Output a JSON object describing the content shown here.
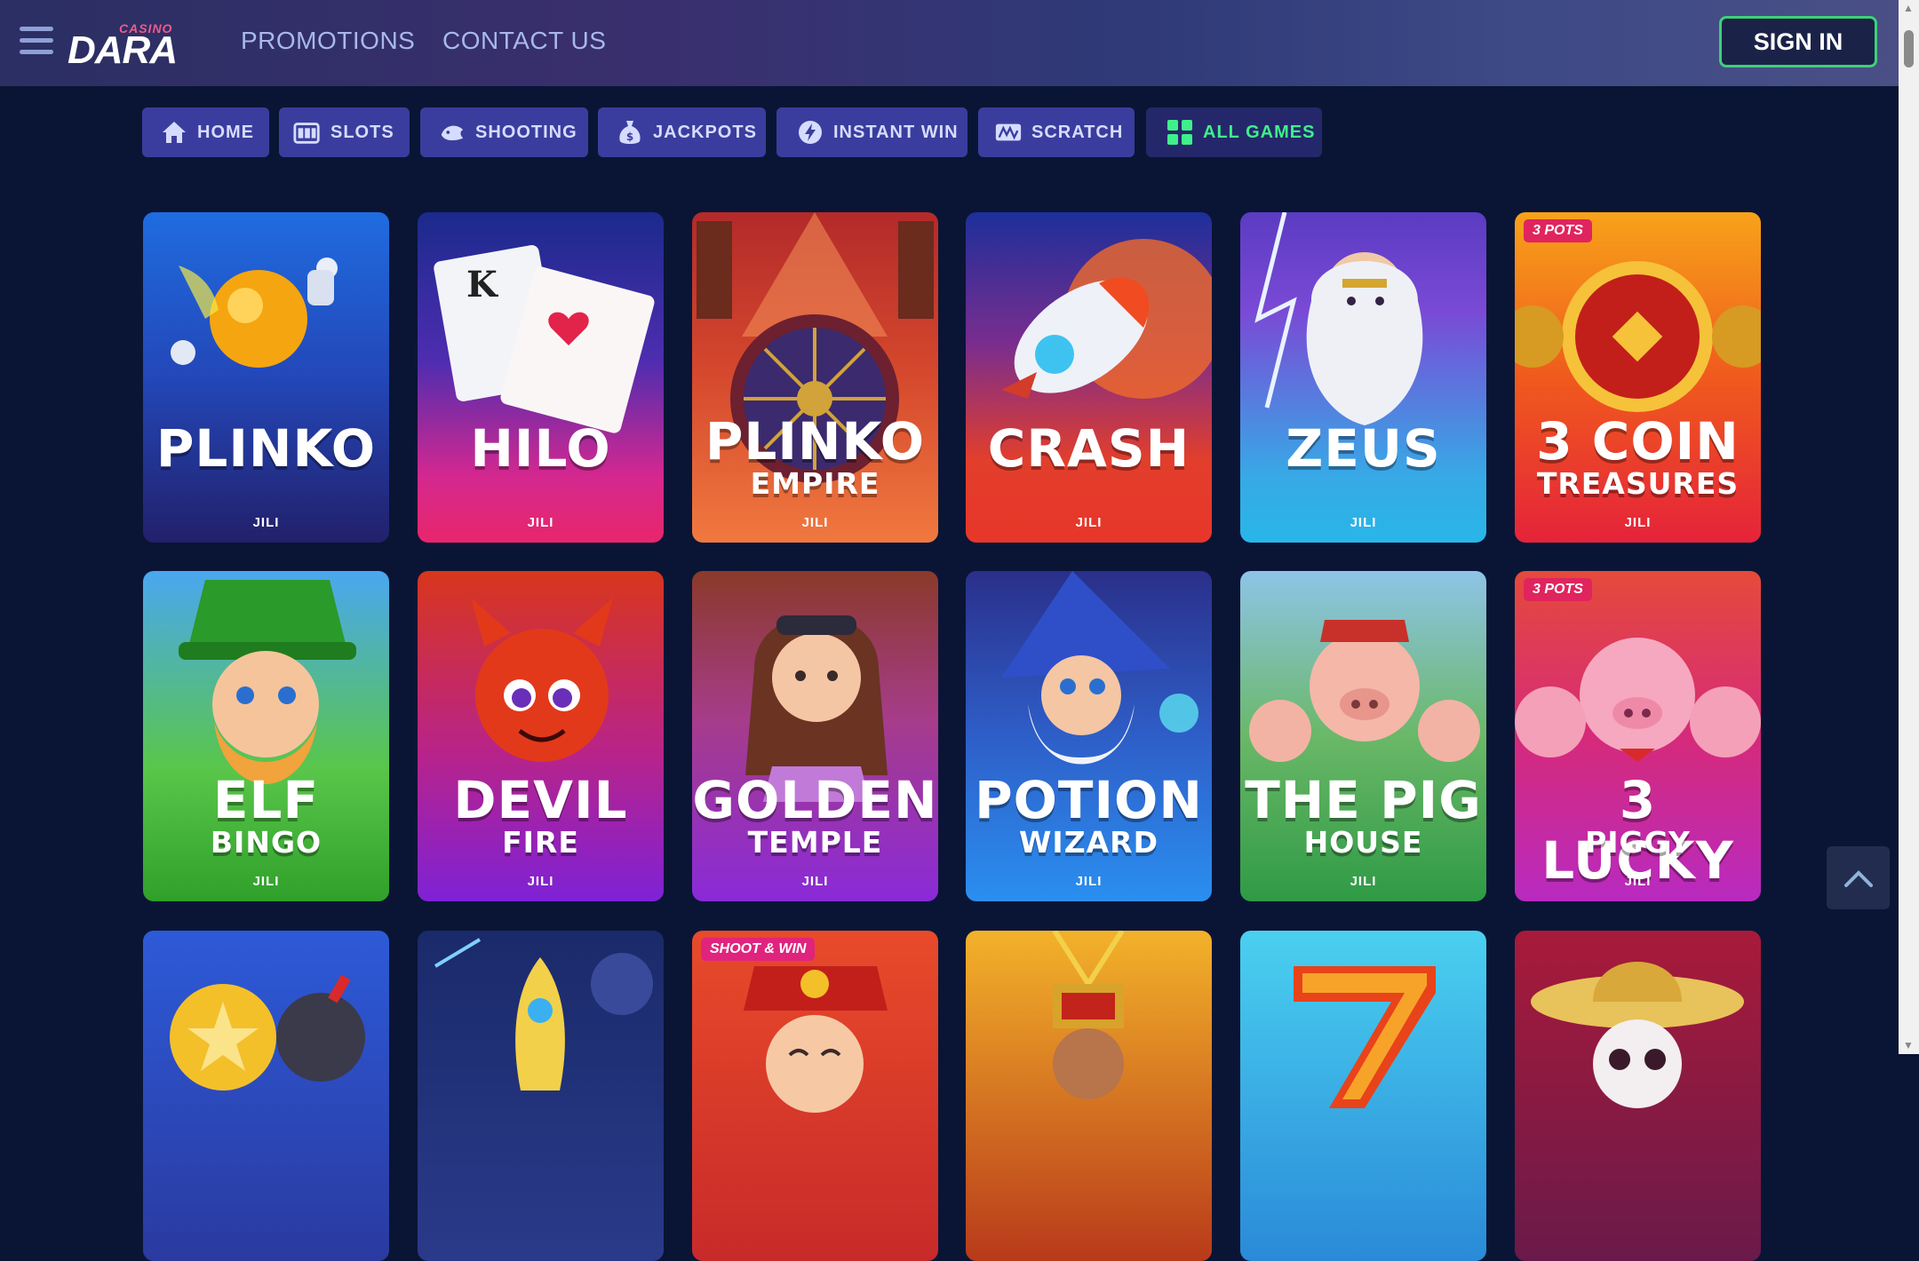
{
  "header": {
    "logo_small": "CASINO",
    "logo_main": "DARA",
    "nav": [
      {
        "label": "PROMOTIONS"
      },
      {
        "label": "CONTACT US"
      }
    ],
    "signin_label": "SIGN IN"
  },
  "categories": [
    {
      "label": "HOME",
      "icon": "home-icon"
    },
    {
      "label": "SLOTS",
      "icon": "slot-machine-icon"
    },
    {
      "label": "SHOOTING",
      "icon": "fish-icon"
    },
    {
      "label": "JACKPOTS",
      "icon": "money-bag-icon"
    },
    {
      "label": "INSTANT WIN",
      "icon": "lightning-icon"
    },
    {
      "label": "SCRATCH",
      "icon": "scratch-card-icon"
    },
    {
      "label": "ALL GAMES",
      "icon": "grid-icon",
      "active": true
    }
  ],
  "games": [
    {
      "title": "PLINKO",
      "subtitle": "",
      "provider": "JILI"
    },
    {
      "title": "HILO",
      "subtitle": "",
      "provider": "JILI"
    },
    {
      "title": "PLINKO",
      "subtitle": "EMPIRE",
      "provider": "JILI"
    },
    {
      "title": "CRASH",
      "subtitle": "",
      "provider": "JILI"
    },
    {
      "title": "ZEUS",
      "subtitle": "",
      "provider": "JILI"
    },
    {
      "title": "3 COIN",
      "subtitle": "TREASURES",
      "provider": "JILI",
      "badge": "3 POTS"
    },
    {
      "title": "ELF",
      "subtitle": "BINGO",
      "provider": "JILI"
    },
    {
      "title": "DEVIL",
      "subtitle": "FIRE",
      "provider": "JILI"
    },
    {
      "title": "GOLDEN",
      "subtitle": "TEMPLE",
      "provider": "JILI"
    },
    {
      "title": "POTION",
      "subtitle": "WIZARD",
      "provider": "JILI"
    },
    {
      "title": "THE PIG",
      "subtitle": "HOUSE",
      "provider": "JILI"
    },
    {
      "title": "3 LUCKY",
      "subtitle": "PIGGY",
      "provider": "JILI",
      "badge": "3 POTS"
    },
    {
      "badge": ""
    },
    {
      "badge": ""
    },
    {
      "badge": "SHOOT & WIN"
    },
    {
      "badge": ""
    },
    {
      "badge": ""
    },
    {
      "badge": ""
    }
  ],
  "colors": {
    "page_bg": "#0a1535",
    "category_bg": "#3b3d9e",
    "active_accent": "#3ff08a",
    "signin_border": "#3fd07a"
  }
}
